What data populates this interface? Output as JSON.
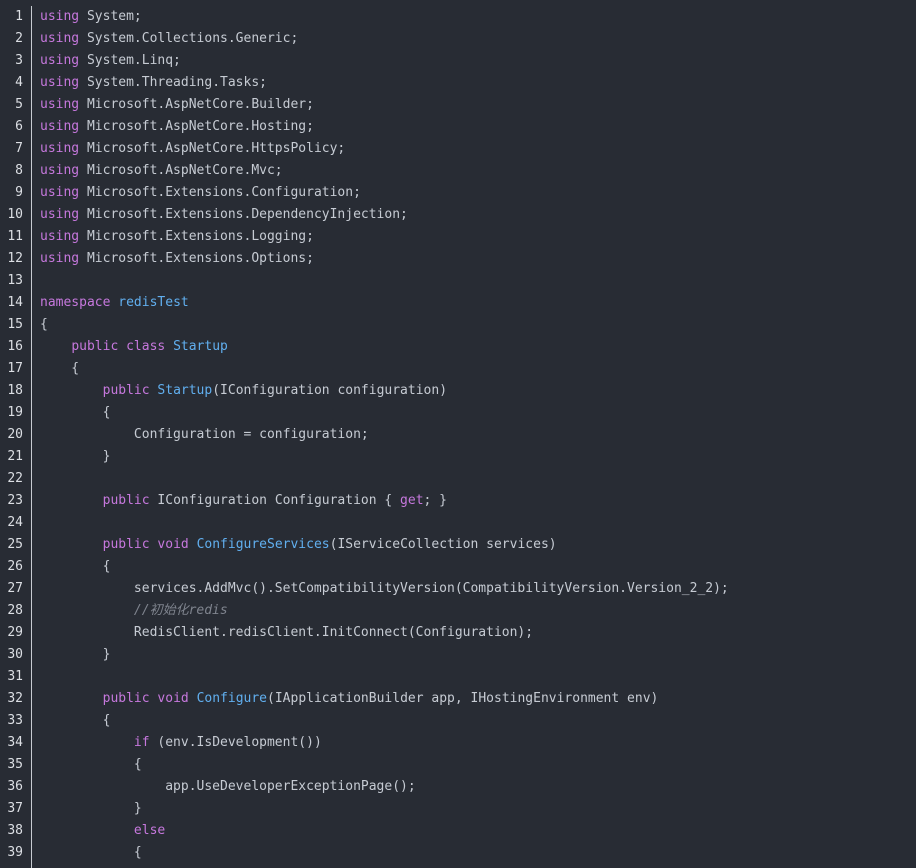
{
  "editor": {
    "lines": [
      [
        {
          "t": "using",
          "c": "kw"
        },
        {
          "t": " System;"
        }
      ],
      [
        {
          "t": "using",
          "c": "kw"
        },
        {
          "t": " System.Collections.Generic;"
        }
      ],
      [
        {
          "t": "using",
          "c": "kw"
        },
        {
          "t": " System.Linq;"
        }
      ],
      [
        {
          "t": "using",
          "c": "kw"
        },
        {
          "t": " System.Threading.Tasks;"
        }
      ],
      [
        {
          "t": "using",
          "c": "kw"
        },
        {
          "t": " Microsoft.AspNetCore.Builder;"
        }
      ],
      [
        {
          "t": "using",
          "c": "kw"
        },
        {
          "t": " Microsoft.AspNetCore.Hosting;"
        }
      ],
      [
        {
          "t": "using",
          "c": "kw"
        },
        {
          "t": " Microsoft.AspNetCore.HttpsPolicy;"
        }
      ],
      [
        {
          "t": "using",
          "c": "kw"
        },
        {
          "t": " Microsoft.AspNetCore.Mvc;"
        }
      ],
      [
        {
          "t": "using",
          "c": "kw"
        },
        {
          "t": " Microsoft.Extensions.Configuration;"
        }
      ],
      [
        {
          "t": "using",
          "c": "kw"
        },
        {
          "t": " Microsoft.Extensions.DependencyInjection;"
        }
      ],
      [
        {
          "t": "using",
          "c": "kw"
        },
        {
          "t": " Microsoft.Extensions.Logging;"
        }
      ],
      [
        {
          "t": "using",
          "c": "kw"
        },
        {
          "t": " Microsoft.Extensions.Options;"
        }
      ],
      [],
      [
        {
          "t": "namespace",
          "c": "kw"
        },
        {
          "t": " "
        },
        {
          "t": "redisTest",
          "c": "fn"
        }
      ],
      [
        {
          "t": "{"
        }
      ],
      [
        {
          "t": "    "
        },
        {
          "t": "public",
          "c": "kw"
        },
        {
          "t": " "
        },
        {
          "t": "class",
          "c": "kw"
        },
        {
          "t": " "
        },
        {
          "t": "Startup",
          "c": "fn"
        }
      ],
      [
        {
          "t": "    {"
        }
      ],
      [
        {
          "t": "        "
        },
        {
          "t": "public",
          "c": "kw"
        },
        {
          "t": " "
        },
        {
          "t": "Startup",
          "c": "fn"
        },
        {
          "t": "(IConfiguration configuration)"
        }
      ],
      [
        {
          "t": "        {"
        }
      ],
      [
        {
          "t": "            Configuration = configuration;"
        }
      ],
      [
        {
          "t": "        }"
        }
      ],
      [],
      [
        {
          "t": "        "
        },
        {
          "t": "public",
          "c": "kw"
        },
        {
          "t": " IConfiguration Configuration { "
        },
        {
          "t": "get",
          "c": "kw"
        },
        {
          "t": "; }"
        }
      ],
      [],
      [
        {
          "t": "        "
        },
        {
          "t": "public",
          "c": "kw"
        },
        {
          "t": " "
        },
        {
          "t": "void",
          "c": "kw"
        },
        {
          "t": " "
        },
        {
          "t": "ConfigureServices",
          "c": "fn"
        },
        {
          "t": "(IServiceCollection services)"
        }
      ],
      [
        {
          "t": "        {"
        }
      ],
      [
        {
          "t": "            services.AddMvc().SetCompatibilityVersion(CompatibilityVersion.Version_2_2);"
        }
      ],
      [
        {
          "t": "            "
        },
        {
          "t": "//初始化redis",
          "c": "cm"
        }
      ],
      [
        {
          "t": "            RedisClient.redisClient.InitConnect(Configuration);"
        }
      ],
      [
        {
          "t": "        }"
        }
      ],
      [],
      [
        {
          "t": "        "
        },
        {
          "t": "public",
          "c": "kw"
        },
        {
          "t": " "
        },
        {
          "t": "void",
          "c": "kw"
        },
        {
          "t": " "
        },
        {
          "t": "Configure",
          "c": "fn"
        },
        {
          "t": "(IApplicationBuilder app, IHostingEnvironment env)"
        }
      ],
      [
        {
          "t": "        {"
        }
      ],
      [
        {
          "t": "            "
        },
        {
          "t": "if",
          "c": "kw"
        },
        {
          "t": " (env.IsDevelopment())"
        }
      ],
      [
        {
          "t": "            {"
        }
      ],
      [
        {
          "t": "                app.UseDeveloperExceptionPage();"
        }
      ],
      [
        {
          "t": "            }"
        }
      ],
      [
        {
          "t": "            "
        },
        {
          "t": "else",
          "c": "kw"
        }
      ],
      [
        {
          "t": "            {"
        }
      ]
    ]
  }
}
